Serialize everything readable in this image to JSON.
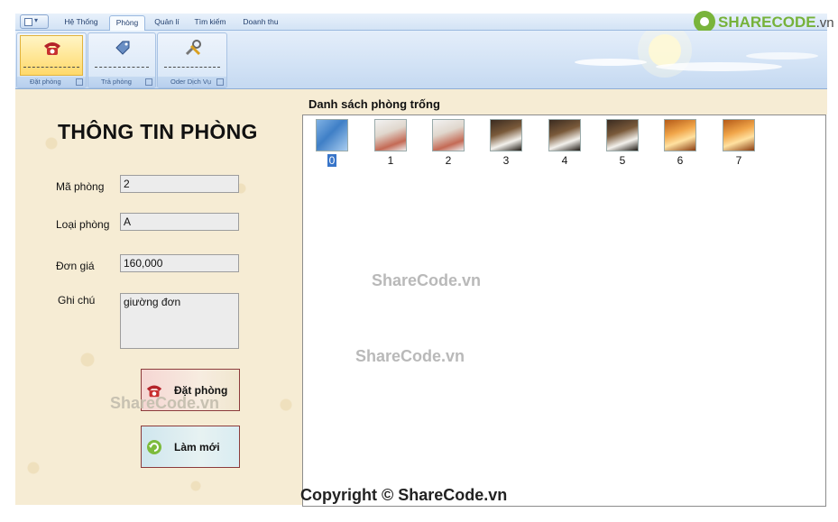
{
  "ribbon": {
    "tabs": [
      {
        "label": "Hệ Thống"
      },
      {
        "label": "Phòng"
      },
      {
        "label": "Quản lí"
      },
      {
        "label": "Tìm kiếm"
      },
      {
        "label": "Doanh thu"
      }
    ],
    "active_tab": "Phòng",
    "groups": [
      {
        "label": "Đặt phòng",
        "icon": "phone-icon",
        "highlighted": true
      },
      {
        "label": "Trả phòng",
        "icon": "tag-icon",
        "highlighted": false
      },
      {
        "label": "Oder Dịch Vụ",
        "icon": "tools-icon",
        "highlighted": false
      }
    ]
  },
  "logo": {
    "brand": "SHARECODE",
    "suffix": ".vn"
  },
  "room_info": {
    "title": "THÔNG TIN PHÒNG",
    "fields": {
      "ma_phong": {
        "label": "Mã phòng",
        "value": "2"
      },
      "loai_phong": {
        "label": "Loại phòng",
        "value": "A"
      },
      "don_gia": {
        "label": "Đơn giá",
        "value": "160,000"
      },
      "ghi_chu": {
        "label": "Ghi chú",
        "value": "giường đơn"
      }
    },
    "buttons": {
      "book": {
        "label": "Đặt phòng",
        "icon": "phone-icon"
      },
      "refresh": {
        "label": "Làm mới",
        "icon": "refresh-icon"
      }
    }
  },
  "room_list": {
    "title": "Danh sách phòng trống",
    "rooms": [
      {
        "label": "0",
        "thumb": "blue",
        "selected": true
      },
      {
        "label": "1",
        "thumb": "white"
      },
      {
        "label": "2",
        "thumb": "white"
      },
      {
        "label": "3",
        "thumb": "dark"
      },
      {
        "label": "4",
        "thumb": "dark"
      },
      {
        "label": "5",
        "thumb": "dark"
      },
      {
        "label": "6",
        "thumb": "gold"
      },
      {
        "label": "7",
        "thumb": "gold"
      }
    ]
  },
  "watermarks": [
    "ShareCode.vn",
    "ShareCode.vn",
    "ShareCode.vn"
  ],
  "copyright": "Copyright © ShareCode.vn",
  "colors": {
    "accent": "#3875c9",
    "panel": "#f6ecd4",
    "ribbon": "#d2e2f5",
    "brand_green": "#76b23a"
  }
}
